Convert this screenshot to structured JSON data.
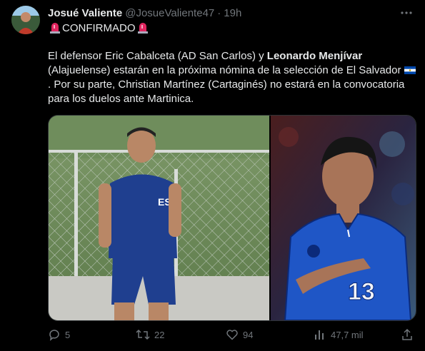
{
  "tweet": {
    "author_name": "Josué Valiente",
    "author_handle": "@JosueValiente47",
    "separator": "·",
    "time": "19h",
    "headline": "CONFIRMADO",
    "text_part1": "El defensor Eric Cabalceta (AD San Carlos) y ",
    "text_bold": "Leonardo Menjívar",
    "text_part2": " (Alajuelense) estarán en la próxima nómina de la selección de El Salvador",
    "text_part3": ". Por su parte, Christian Martínez (Cartaginés) no estará en la convocatoria para los duelos ante Martinica."
  },
  "media": {
    "left_shirt_text": "ES",
    "right_shirt_number": "13"
  },
  "actions": {
    "replies": "5",
    "reposts": "22",
    "likes": "94",
    "views": "47,7 mil"
  },
  "icons": {
    "more": "more-horizontal-icon",
    "siren": "police-light-icon",
    "flag": "el-salvador-flag-icon",
    "reply": "reply-icon",
    "repost": "repost-icon",
    "like": "heart-icon",
    "views": "views-icon",
    "share": "share-icon"
  },
  "colors": {
    "background": "#000000",
    "text": "#e7e9ea",
    "muted": "#71767b",
    "siren_red": "#e0245e"
  }
}
